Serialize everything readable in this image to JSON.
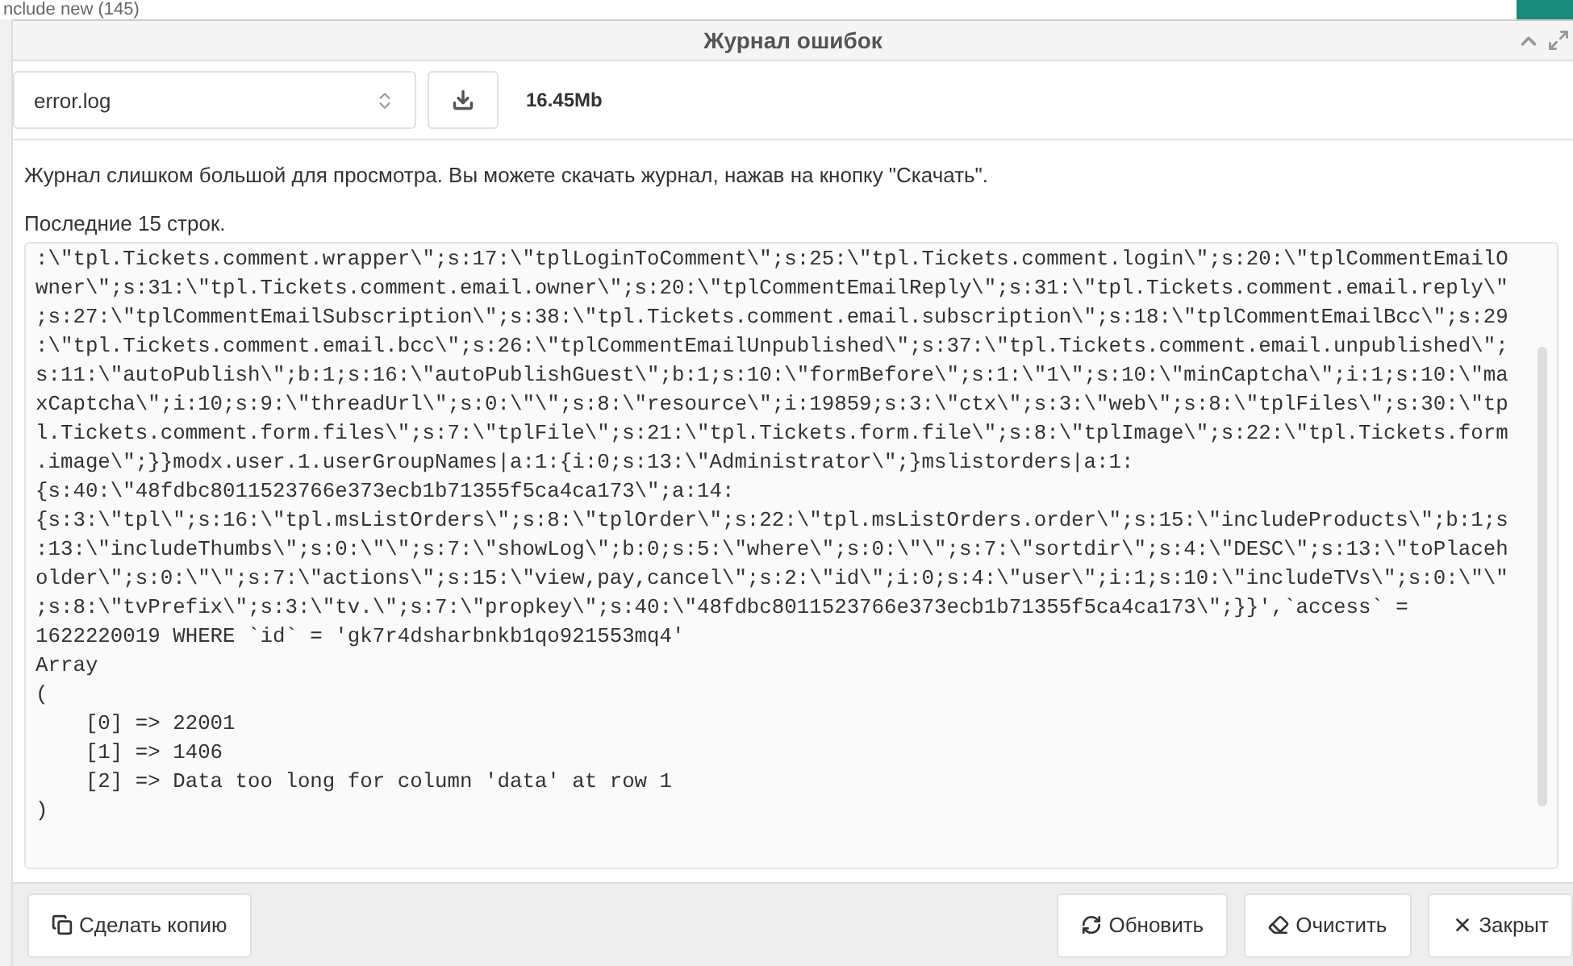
{
  "background_page": {
    "heading": "nclude new (145)"
  },
  "dialog": {
    "title": "Журнал ошибок"
  },
  "toolbar": {
    "file_select": {
      "value": "error.log"
    },
    "file_size": "16.45Mb"
  },
  "message": "Журнал слишком большой для просмотра. Вы можете скачать журнал, нажав на кнопку \"Скачать\".",
  "last_lines_label": "Последние 15 строк.",
  "log_lines": [
    ":\\\"tpl.Tickets.comment.wrapper\\\";s:17:\\\"tplLoginToComment\\\";s:25:\\\"tpl.Tickets.comment.login\\\";s:20:\\\"tplCommentEmailO",
    "wner\\\";s:31:\\\"tpl.Tickets.comment.email.owner\\\";s:20:\\\"tplCommentEmailReply\\\";s:31:\\\"tpl.Tickets.comment.email.reply\\\"",
    ";s:27:\\\"tplCommentEmailSubscription\\\";s:38:\\\"tpl.Tickets.comment.email.subscription\\\";s:18:\\\"tplCommentEmailBcc\\\";s:29",
    ":\\\"tpl.Tickets.comment.email.bcc\\\";s:26:\\\"tplCommentEmailUnpublished\\\";s:37:\\\"tpl.Tickets.comment.email.unpublished\\\";",
    "s:11:\\\"autoPublish\\\";b:1;s:16:\\\"autoPublishGuest\\\";b:1;s:10:\\\"formBefore\\\";s:1:\\\"1\\\";s:10:\\\"minCaptcha\\\";i:1;s:10:\\\"ma",
    "xCaptcha\\\";i:10;s:9:\\\"threadUrl\\\";s:0:\\\"\\\";s:8:\\\"resource\\\";i:19859;s:3:\\\"ctx\\\";s:3:\\\"web\\\";s:8:\\\"tplFiles\\\";s:30:\\\"tp",
    "l.Tickets.comment.form.files\\\";s:7:\\\"tplFile\\\";s:21:\\\"tpl.Tickets.form.file\\\";s:8:\\\"tplImage\\\";s:22:\\\"tpl.Tickets.form",
    ".image\\\";}}modx.user.1.userGroupNames|a:1:{i:0;s:13:\\\"Administrator\\\";}mslistorders|a:1:",
    "{s:40:\\\"48fdbc8011523766e373ecb1b71355f5ca4ca173\\\";a:14:",
    "{s:3:\\\"tpl\\\";s:16:\\\"tpl.msListOrders\\\";s:8:\\\"tplOrder\\\";s:22:\\\"tpl.msListOrders.order\\\";s:15:\\\"includeProducts\\\";b:1;s",
    ":13:\\\"includeThumbs\\\";s:0:\\\"\\\";s:7:\\\"showLog\\\";b:0;s:5:\\\"where\\\";s:0:\\\"\\\";s:7:\\\"sortdir\\\";s:4:\\\"DESC\\\";s:13:\\\"toPlaceh",
    "older\\\";s:0:\\\"\\\";s:7:\\\"actions\\\";s:15:\\\"view,pay,cancel\\\";s:2:\\\"id\\\";i:0;s:4:\\\"user\\\";i:1;s:10:\\\"includeTVs\\\";s:0:\\\"\\\"",
    ";s:8:\\\"tvPrefix\\\";s:3:\\\"tv.\\\";s:7:\\\"propkey\\\";s:40:\\\"48fdbc8011523766e373ecb1b71355f5ca4ca173\\\";}}',`access` =",
    "1622220019 WHERE `id` = 'gk7r4dsharbnkb1qo921553mq4'",
    "Array",
    "(",
    "    [0] => 22001",
    "    [1] => 1406",
    "    [2] => Data too long for column 'data' at row 1",
    ")"
  ],
  "footer": {
    "left_buttons": [
      {
        "label": "Сделать копию",
        "kind": "copy"
      }
    ],
    "right_buttons": [
      {
        "label": "Обновить",
        "kind": "refresh"
      },
      {
        "label": "Очистить",
        "kind": "clear"
      },
      {
        "label": "Закрыт",
        "kind": "close"
      }
    ]
  }
}
